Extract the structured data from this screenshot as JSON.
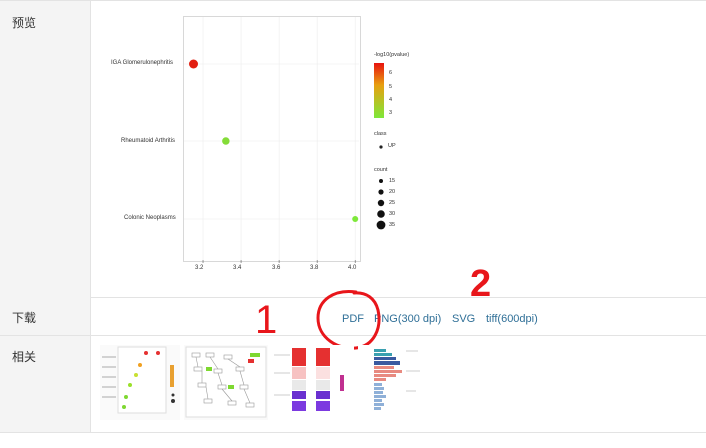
{
  "rows": {
    "preview_label": "预览",
    "download_label": "下载",
    "related_label": "相关"
  },
  "chart_data": {
    "type": "scatter",
    "categories": [
      "IGA Glomerulonephritis",
      "Rheumatoid Arthritis",
      "Colonic Neoplasms"
    ],
    "points": [
      {
        "term": "IGA Glomerulonephritis",
        "x": 3.15,
        "count": 25,
        "neglog10_pvalue": 6.3,
        "class": "UP"
      },
      {
        "term": "Rheumatoid Arthritis",
        "x": 3.32,
        "count": 20,
        "neglog10_pvalue": 3.2,
        "class": "UP"
      },
      {
        "term": "Colonic Neoplasms",
        "x": 4.0,
        "count": 15,
        "neglog10_pvalue": 3.0,
        "class": "UP"
      }
    ],
    "xlim": [
      3.1,
      4.02
    ],
    "x_ticks": [
      "3.2",
      "3.4",
      "3.6",
      "3.8",
      "4.0"
    ],
    "grid": true,
    "legend": {
      "color_title": "-log10(pvalue)",
      "color_ticks": [
        "6",
        "5",
        "4",
        "3"
      ],
      "color_low": "#7ee83a",
      "color_high": "#e8130f",
      "class_title": "class",
      "class_item": "UP",
      "size_title": "count",
      "size_ticks": [
        "15",
        "20",
        "25",
        "30",
        "35"
      ],
      "placement": "right"
    }
  },
  "downloads": {
    "pdf": "PDF",
    "png": "PNG(300 dpi)",
    "svg": "SVG",
    "tiff": "tiff(600dpi)"
  },
  "annotations": {
    "mark_1": "1",
    "mark_2": "2",
    "ink_color": "#e8161b"
  },
  "colors": {
    "link": "#2f6f97",
    "label_bg": "#f4f4f4",
    "border": "#e3e3e3"
  }
}
